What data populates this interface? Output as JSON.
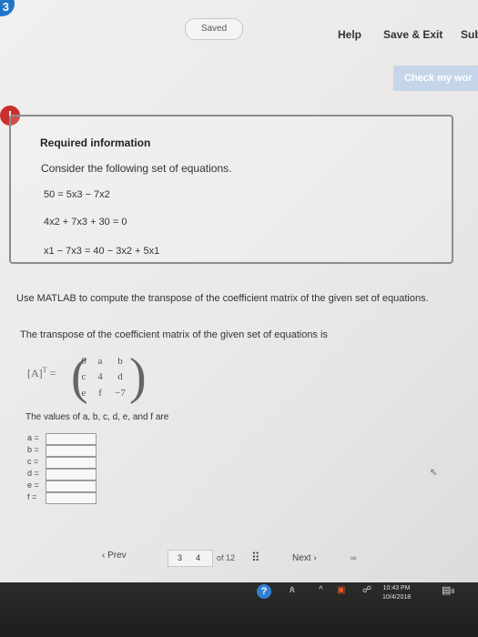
{
  "header": {
    "badge_digit": "3",
    "saved_label": "Saved",
    "help_label": "Help",
    "save_exit_label": "Save & Exit",
    "submit_label": "Sub",
    "check_label": "Check my wor"
  },
  "alert": {
    "icon": "!",
    "title": "Required information",
    "intro": "Consider the following set of equations.",
    "equations": [
      "50 = 5x3 − 7x2",
      "4x2 + 7x3 + 30 = 0",
      "x1 − 7x3 = 40 − 3x2 + 5x1"
    ]
  },
  "question": {
    "prompt": "Use MATLAB to compute the transpose of the coefficient matrix of the given set of equations.",
    "transpose_text": "The transpose of the coefficient matrix of the given set of equations is",
    "matrix_label": "[A]",
    "matrix_sup": "T",
    "matrix_eq": "=",
    "matrix": [
      [
        "0",
        "a",
        "b"
      ],
      [
        "c",
        "4",
        "d"
      ],
      [
        "e",
        "f",
        "−7"
      ]
    ],
    "values_text": "The values of a, b, c, d, e, and f are",
    "inputs": [
      {
        "label": "a =",
        "value": ""
      },
      {
        "label": "b =",
        "value": ""
      },
      {
        "label": "c =",
        "value": ""
      },
      {
        "label": "d =",
        "value": ""
      },
      {
        "label": "e =",
        "value": ""
      },
      {
        "label": "f =",
        "value": ""
      }
    ]
  },
  "pager": {
    "prev_label": "Prev",
    "page_prev": "3",
    "page_current": "4",
    "of_label": "of 12",
    "next_label": "Next"
  },
  "taskbar": {
    "time": "10:43 PM",
    "date": "10/4/2018",
    "notif_count": "8"
  }
}
